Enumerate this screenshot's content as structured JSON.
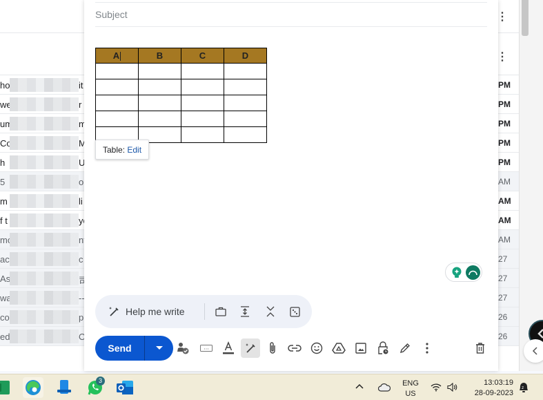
{
  "inbox": {
    "rows": [
      {
        "sender": "ho",
        "subject": "it",
        "time": "PM",
        "read": false
      },
      {
        "sender": "we",
        "subject": "r",
        "time": "PM",
        "read": false
      },
      {
        "sender": "um",
        "subject": "m",
        "time": "PM",
        "read": false
      },
      {
        "sender": "Co",
        "subject": "Ma",
        "time": "PM",
        "read": false
      },
      {
        "sender": " h",
        "subject": "U",
        "time": "PM",
        "read": false
      },
      {
        "sender": " 5",
        "subject": "o",
        "time": "AM",
        "read": true
      },
      {
        "sender": "m I",
        "subject": "li",
        "time": "AM",
        "read": false
      },
      {
        "sender": "f t",
        "subject": "yo",
        "time": "AM",
        "read": false
      },
      {
        "sender": "mo",
        "subject": "nt",
        "time": "AM",
        "read": true
      },
      {
        "sender": "ac",
        "subject": "c",
        "time": "27",
        "read": true
      },
      {
        "sender": " As",
        "subject": "司",
        "time": "27",
        "read": true
      },
      {
        "sender": "wa",
        "subject": "--",
        "time": "27",
        "read": true
      },
      {
        "sender": "co",
        "subject": "p",
        "time": "26",
        "read": true
      },
      {
        "sender": "ed",
        "subject": "O",
        "time": "26",
        "read": true
      }
    ]
  },
  "compose": {
    "subject_placeholder": "Subject",
    "table": {
      "headers": [
        "A",
        "B",
        "C",
        "D"
      ],
      "rows": [
        [
          "",
          "",
          "",
          ""
        ],
        [
          "",
          "",
          "",
          ""
        ],
        [
          "",
          "",
          "",
          ""
        ],
        [
          "",
          "",
          "",
          ""
        ],
        [
          "",
          "",
          "",
          ""
        ]
      ],
      "header_color": "#a57822"
    },
    "table_popup": {
      "label": "Table:",
      "edit_link": "Edit"
    },
    "help_me_write": {
      "label": "Help me write",
      "icons": [
        "briefcase-icon",
        "expand-vertical-icon",
        "collapse-vertical-icon",
        "dice-icon"
      ]
    },
    "toolbar": {
      "send_label": "Send",
      "icons": [
        "signature-check-icon",
        "keyboard-icon",
        "text-format-icon",
        "sparkle-pen-icon",
        "attach-icon",
        "link-icon",
        "emoji-icon",
        "drive-icon",
        "image-icon",
        "confidential-lock-icon",
        "pen-icon",
        "more-options-icon"
      ],
      "delete_icon": "trash-icon"
    },
    "accent_color": "#0b57d0"
  },
  "taskbar": {
    "apps": [
      {
        "name": "excel",
        "badge": null
      },
      {
        "name": "edge",
        "badge": null
      },
      {
        "name": "phone-link",
        "badge": null
      },
      {
        "name": "whatsapp",
        "badge": "3"
      },
      {
        "name": "outlook",
        "badge": null
      }
    ],
    "language": {
      "line1": "ENG",
      "line2": "US"
    },
    "clock": {
      "time": "13:03:19",
      "date": "28-09-2023"
    }
  }
}
